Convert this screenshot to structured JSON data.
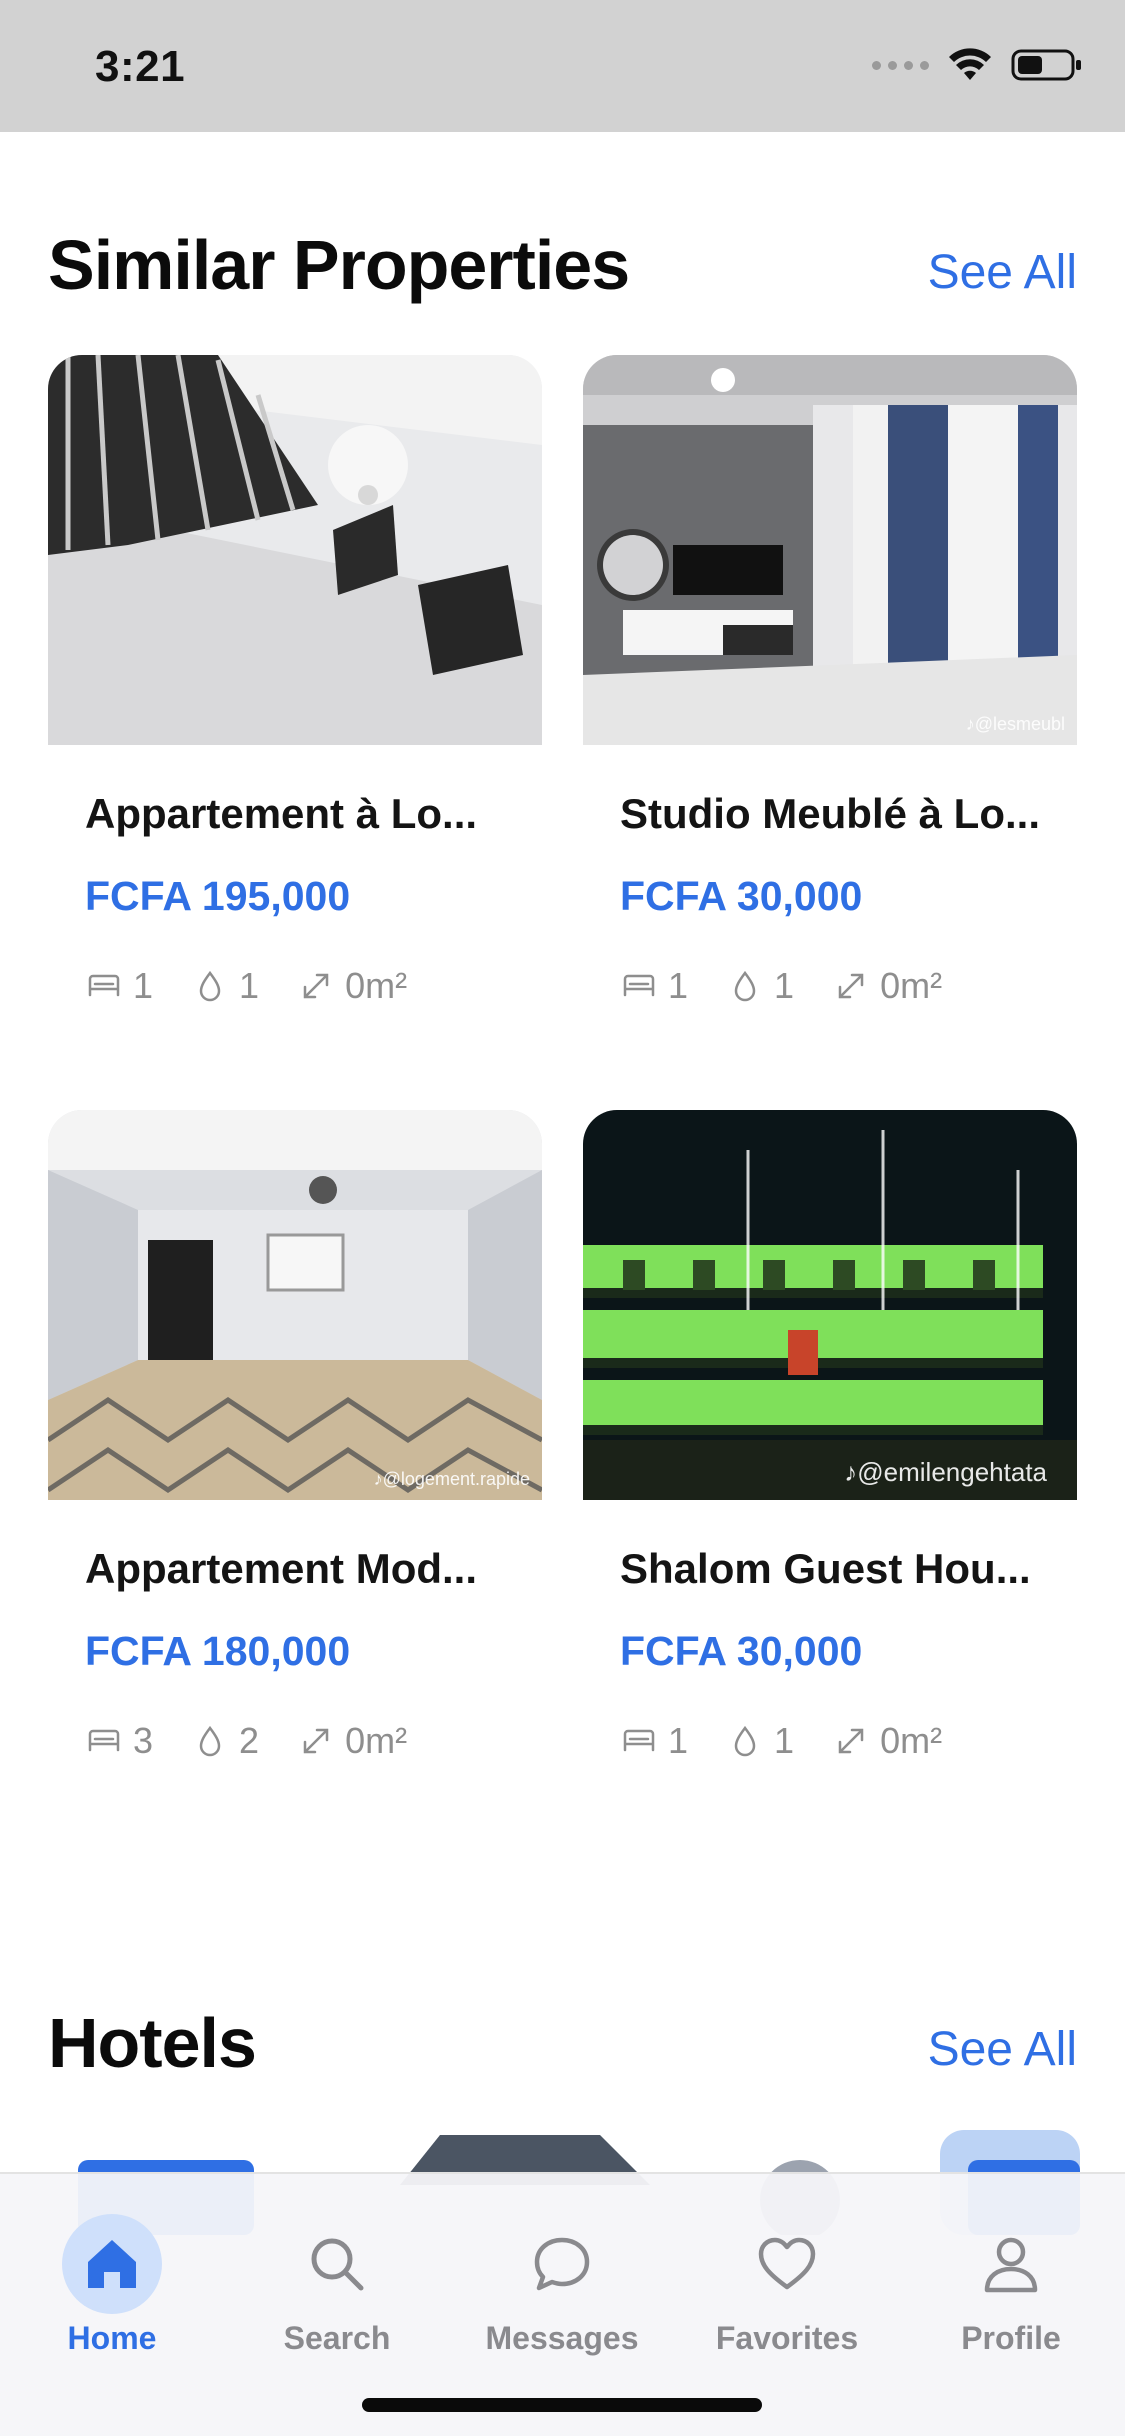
{
  "status_bar": {
    "time": "3:21"
  },
  "similar": {
    "title": "Similar Properties",
    "see_all": "See All",
    "cards": [
      {
        "title": "Appartement à Lo...",
        "price": "FCFA 195,000",
        "beds": "1",
        "baths": "1",
        "area": "0m²",
        "watermark": ""
      },
      {
        "title": "Studio Meublé à Lo...",
        "price": "FCFA 30,000",
        "beds": "1",
        "baths": "1",
        "area": "0m²",
        "watermark": "♪@lesmeubl"
      },
      {
        "title": "Appartement Mod...",
        "price": "FCFA 180,000",
        "beds": "3",
        "baths": "2",
        "area": "0m²",
        "watermark": "♪@logement.rapide"
      },
      {
        "title": "Shalom Guest Hou...",
        "price": "FCFA 30,000",
        "beds": "1",
        "baths": "1",
        "area": "0m²",
        "watermark": "♪@emilengehtata"
      }
    ]
  },
  "hotels": {
    "title": "Hotels",
    "see_all": "See All"
  },
  "tabs": [
    {
      "label": "Home",
      "icon": "home-icon",
      "active": true
    },
    {
      "label": "Search",
      "icon": "search-icon",
      "active": false
    },
    {
      "label": "Messages",
      "icon": "message-icon",
      "active": false
    },
    {
      "label": "Favorites",
      "icon": "heart-icon",
      "active": false
    },
    {
      "label": "Profile",
      "icon": "person-icon",
      "active": false
    }
  ],
  "colors": {
    "accent": "#2f6fe4",
    "accent_light": "#cfe0fb",
    "status_bar_bg": "#d2d2d2",
    "meta_gray": "#8e8e8e"
  }
}
